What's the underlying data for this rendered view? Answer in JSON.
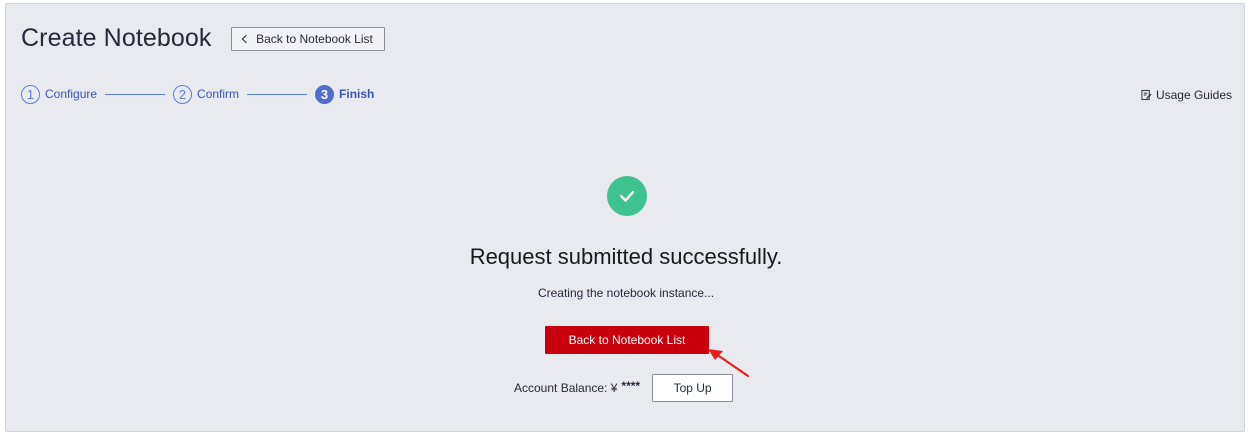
{
  "header": {
    "title": "Create Notebook",
    "back_button_label": "Back to Notebook List"
  },
  "steps": [
    {
      "number": "1",
      "label": "Configure",
      "state": "done"
    },
    {
      "number": "2",
      "label": "Confirm",
      "state": "done"
    },
    {
      "number": "3",
      "label": "Finish",
      "state": "active"
    }
  ],
  "usage_guides_label": "Usage Guides",
  "result": {
    "icon": "check-circle-icon",
    "title": "Request submitted successfully.",
    "subtitle": "Creating the notebook instance...",
    "primary_button_label": "Back to Notebook List"
  },
  "balance": {
    "label": "Account Balance: ¥",
    "value": "****",
    "top_up_label": "Top Up"
  },
  "colors": {
    "accent": "#526ecc",
    "primary_button": "#c7000b",
    "success": "#3ec28f",
    "annotation_arrow": "#e8201c"
  }
}
